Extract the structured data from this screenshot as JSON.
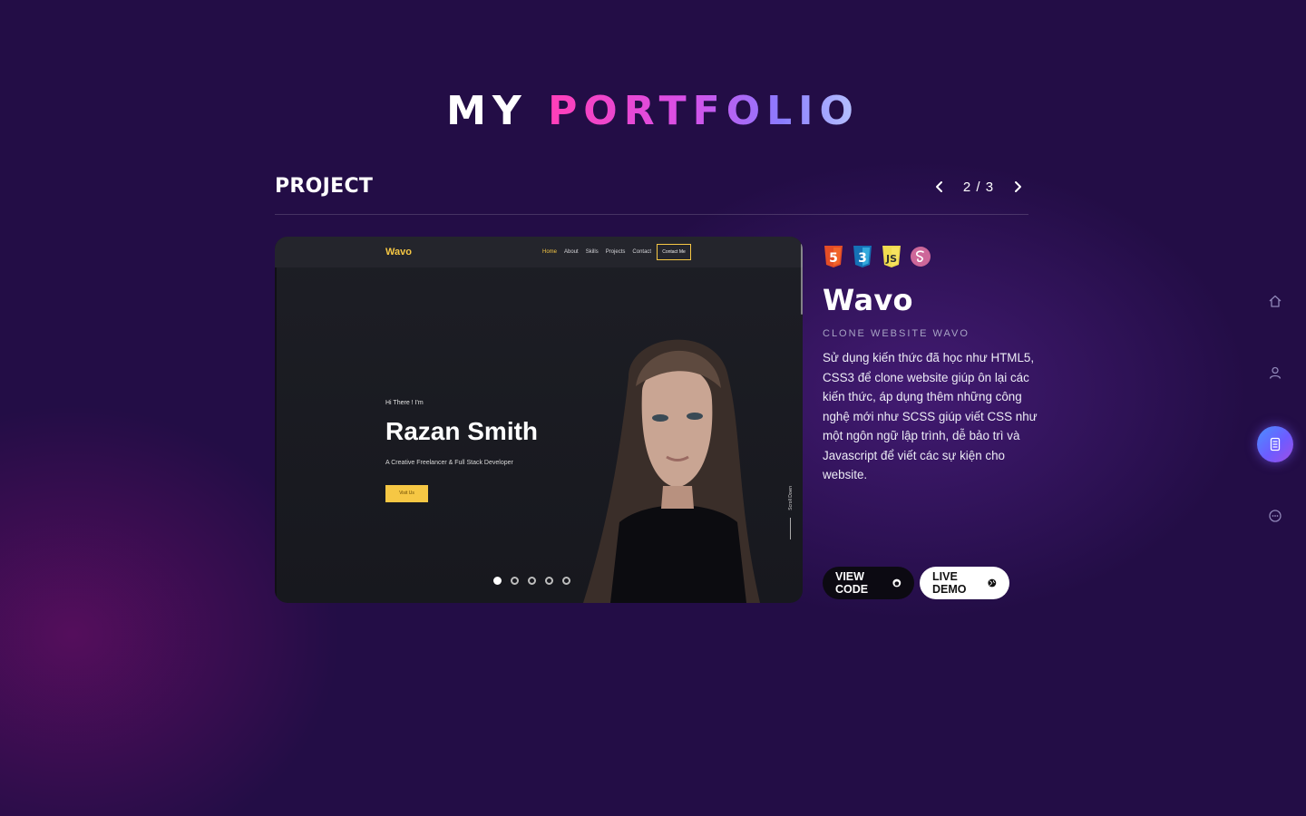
{
  "header": {
    "title_part1": "MY",
    "title_part2": "PORTFOLIO"
  },
  "section": {
    "title": "PROJECT",
    "pager": {
      "current": "2",
      "total": "3",
      "label": "2 / 3",
      "prev_icon": "chevron-left-icon",
      "next_icon": "chevron-right-icon"
    }
  },
  "preview": {
    "logo": "Wavo",
    "menu": [
      "Home",
      "About",
      "Skills",
      "Projects",
      "Contact"
    ],
    "contact_button": "Contact Me",
    "greeting": "Hi There ! I'm",
    "name": "Razan Smith",
    "subtitle": "A Creative Freelancer & Full Stack Developer",
    "cta": "Visit Us",
    "scroll_label": "Scroll Down",
    "dots_total": 5,
    "dots_active": 1,
    "accent_color": "#f6c744"
  },
  "project": {
    "tech_icons": [
      "html5-icon",
      "css3-icon",
      "javascript-icon",
      "sass-icon"
    ],
    "title": "Wavo",
    "subtitle": "CLONE WEBSITE WAVO",
    "description": "Sử dụng kiến thức đã học như HTML5, CSS3 để clone website giúp ôn lại các kiến thức, áp dụng thêm những công nghệ mới như SCSS giúp viết CSS như một ngôn ngữ lập trình, dễ bảo trì và Javascript để viết các sự kiện cho website.",
    "view_code_label": "VIEW CODE",
    "live_demo_label": "LIVE DEMO"
  },
  "side_nav": {
    "items": [
      {
        "icon": "home-icon",
        "active": false
      },
      {
        "icon": "user-icon",
        "active": false
      },
      {
        "icon": "document-icon",
        "active": true
      },
      {
        "icon": "chat-icon",
        "active": false
      }
    ]
  },
  "colors": {
    "background": "#230d46",
    "gradient_start": "#ff3fb8",
    "gradient_end": "#8a7bff",
    "html5": "#e44d26",
    "css3": "#2965f1",
    "javascript": "#f0db4f",
    "sass": "#cd6799"
  }
}
